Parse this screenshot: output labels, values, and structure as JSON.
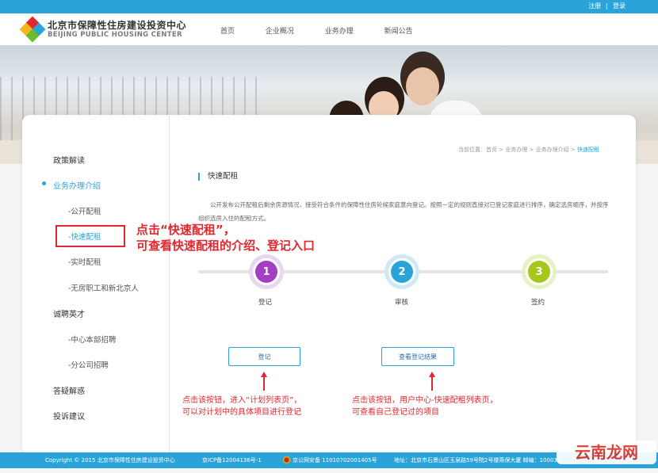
{
  "topbar": {
    "register": "注册",
    "sep": "|",
    "login": "登录"
  },
  "brand": {
    "cn": "北京市保障性住房建设投资中心",
    "en": "BEIJING PUBLIC HOUSING CENTER"
  },
  "nav": [
    "首页",
    "企业概况",
    "业务办理",
    "新闻公告"
  ],
  "sidebar": {
    "policy": "政策解读",
    "business": "业务办理介绍",
    "sub": [
      "-公开配租",
      "-快速配租",
      "-实时配租",
      "-无房职工和新北京人"
    ],
    "recruit": "诚聘英才",
    "recruit_sub": [
      "-中心本部招聘",
      "-分公司招聘"
    ],
    "faq": "答疑解惑",
    "complaint": "投诉建议"
  },
  "breadcrumb": {
    "prefix": "当前位置：首页 > 业务办理 > 业务办理介绍 > ",
    "current": "快速配租"
  },
  "section_title": "快速配租",
  "description": "公开发布公开配租后剩余房源情况，接受符合条件的保障性住房轮候家庭意向登记。按照一定的规则直接对已登记家庭进行排序，确定选房顺序，并按序组织选房入住的配租方式。",
  "annotation": {
    "line1": "点击“快速配租”，",
    "line2": "可查看快速配租的介绍、登记入口"
  },
  "steps": [
    {
      "num": "1",
      "label": "登记",
      "color": "#a23fc4"
    },
    {
      "num": "2",
      "label": "审核",
      "color": "#2aa3d9"
    },
    {
      "num": "3",
      "label": "签约",
      "color": "#a6c81c"
    }
  ],
  "buttons": {
    "register": "登记",
    "check_result": "查看登记结果"
  },
  "notes": {
    "left_1": "点击该按钮，进入“计划列表页”，",
    "left_2": "可以对计划中的具体项目进行登记",
    "right_1": "点击该按钮，用户中心-快速配租列表页，",
    "right_2": "可查看自己登记过的项目"
  },
  "footer": {
    "copyright": "Copyright © 2015 北京市保障性住房建设投资中心",
    "icp": "京ICP备12004136号-1",
    "police": "京公网安备 11010702001405号",
    "address": "地址：北京市石景山区玉泉路59号院2号楼燕保大厦 邮编：100039"
  },
  "watermark": "云南龙网",
  "colors": {
    "accent": "#2aa3d9",
    "annotation": "#e0282f"
  }
}
